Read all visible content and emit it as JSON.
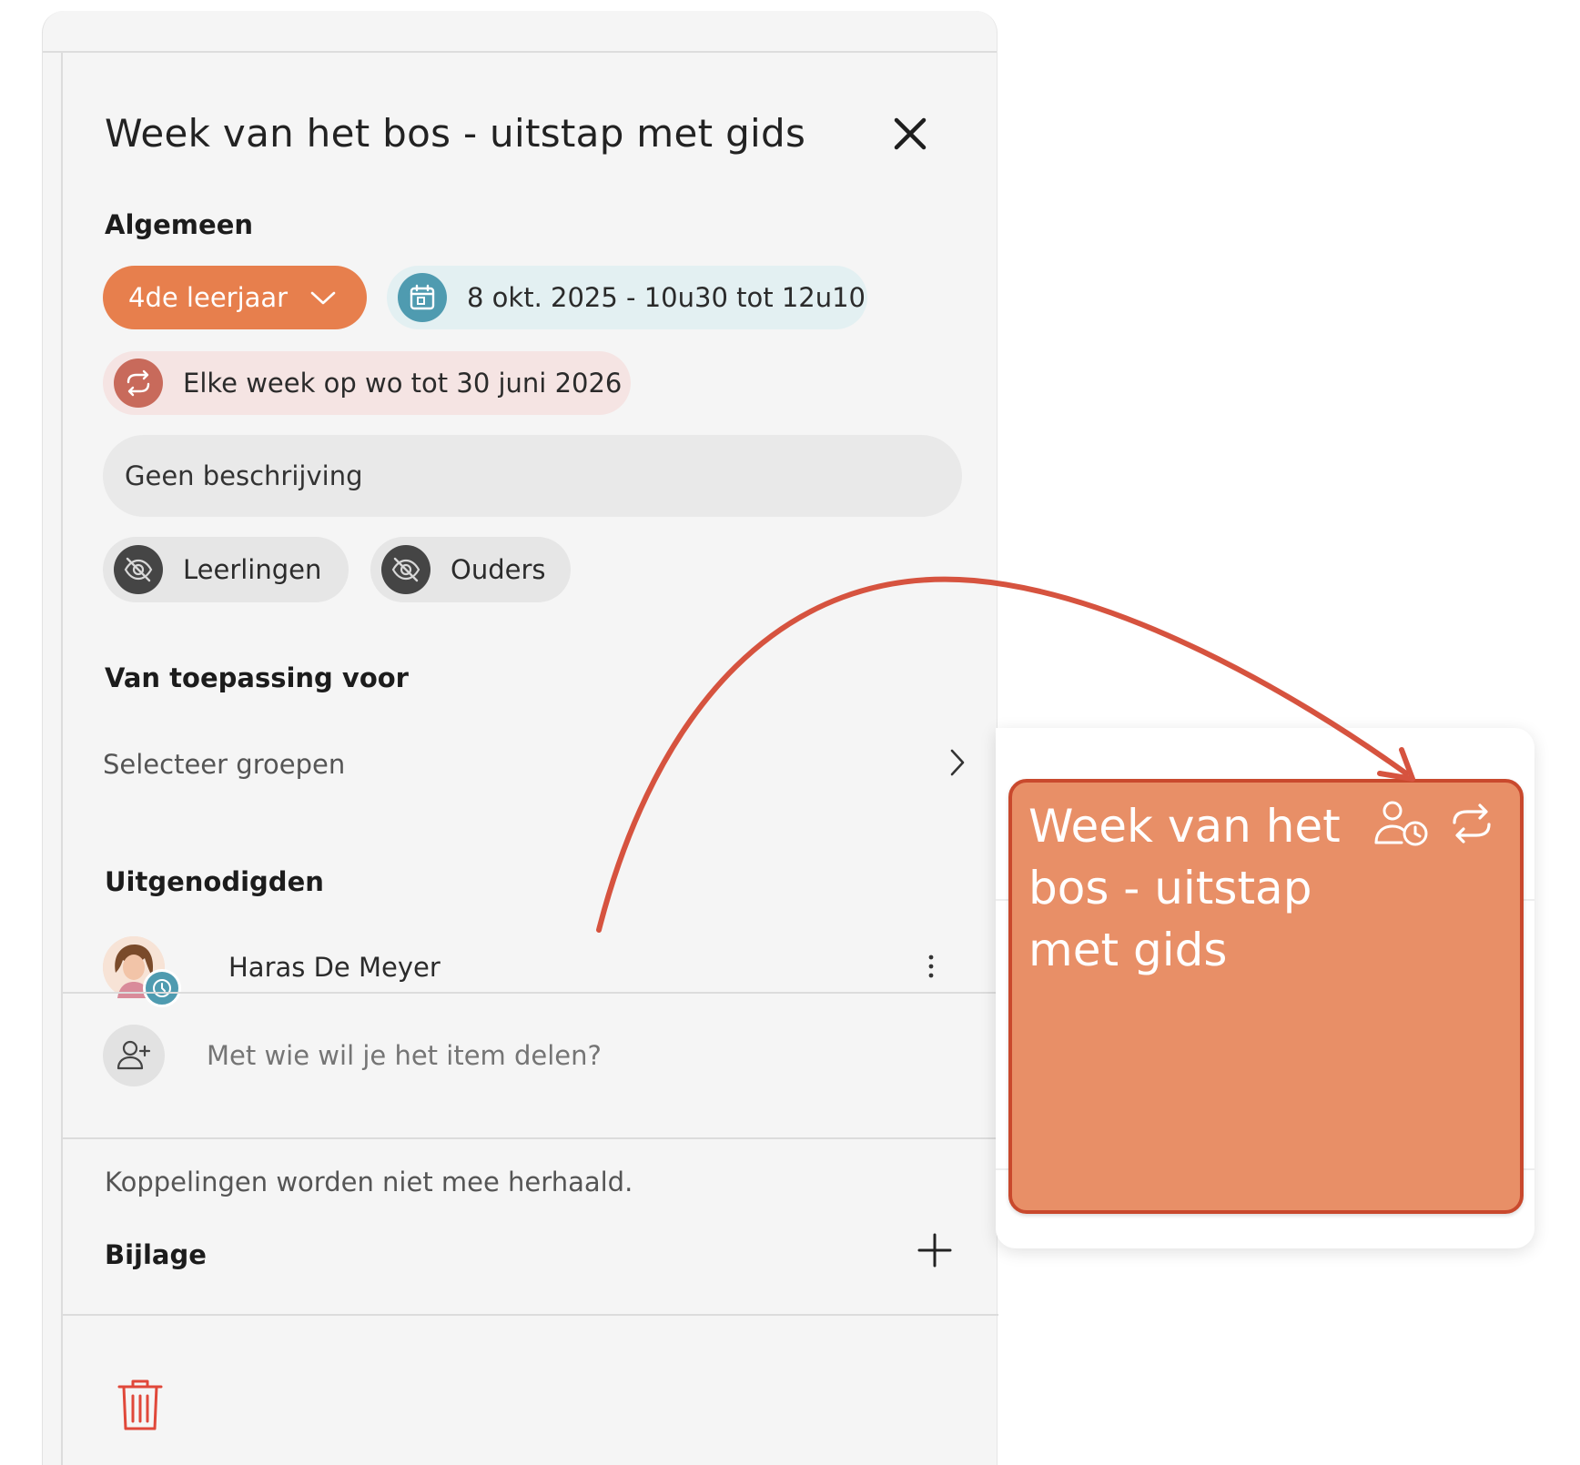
{
  "dialog": {
    "title": "Week van het bos - uitstap met gids"
  },
  "general": {
    "heading": "Algemeen",
    "year_label": "4de leerjaar",
    "date_label": "8 okt. 2025 - 10u30 tot 12u10",
    "repeat_label": "Elke week op wo tot 30 juni 2026",
    "description": "Geen beschrijving",
    "visibility": [
      {
        "label": "Leerlingen",
        "icon": "eye-off-icon"
      },
      {
        "label": "Ouders",
        "icon": "eye-off-icon"
      }
    ]
  },
  "applies_to": {
    "heading": "Van toepassing voor",
    "select_label": "Selecteer groepen"
  },
  "invitees": {
    "heading": "Uitgenodigden",
    "list": [
      {
        "name": "Haras De Meyer"
      }
    ],
    "share_placeholder": "Met wie wil je het item delen?"
  },
  "note": "Koppelingen worden niet mee herhaald.",
  "attachment": {
    "heading": "Bijlage"
  },
  "calendar_card": {
    "title": "Week van het bos - uitstap met gids",
    "icons": [
      "person-clock-icon",
      "repeat-icon"
    ]
  },
  "colors": {
    "accent_orange": "#e77f4d",
    "date_chip_bg": "#e3f0f2",
    "date_icon": "#4f9bb0",
    "repeat_chip_bg": "#f5e4e3",
    "repeat_icon": "#c86a5b",
    "card_bg": "#e88f67",
    "card_border": "#c9492d",
    "arrow": "#d6533f",
    "trash": "#e0483a"
  }
}
